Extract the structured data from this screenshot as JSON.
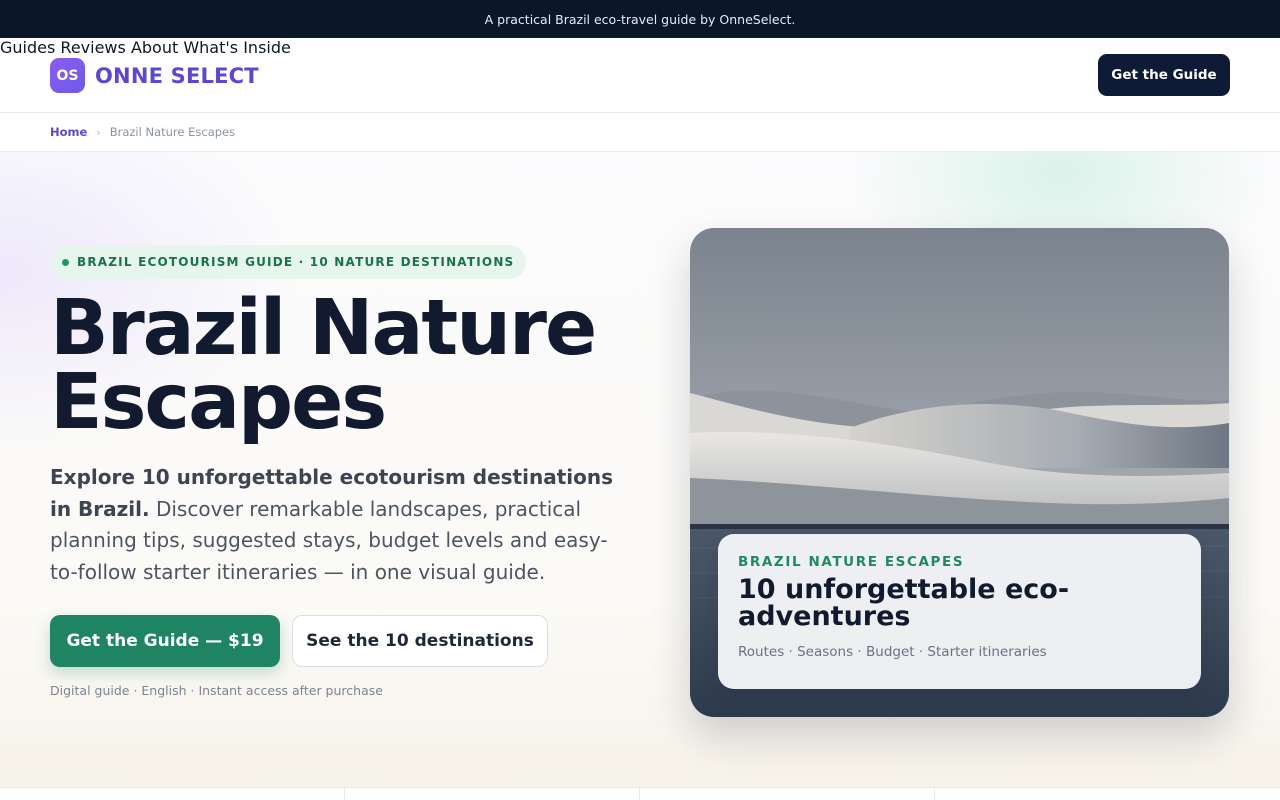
{
  "announcement": "A practical Brazil eco-travel guide by OnneSelect.",
  "brand": {
    "mark": "OS",
    "name": "ONNE SELECT"
  },
  "nav": {
    "items": [
      {
        "label": "Guides"
      },
      {
        "label": "Reviews"
      },
      {
        "label": "About"
      },
      {
        "label": "What's Inside"
      }
    ],
    "cta": "Get the Guide"
  },
  "breadcrumb": {
    "home": "Home",
    "separator": "›",
    "current": "Brazil Nature Escapes"
  },
  "hero": {
    "pill": "BRAZIL ECOTOURISM GUIDE · 10 NATURE DESTINATIONS",
    "title_line1": "Brazil Nature",
    "title_line2": "Escapes",
    "lead_strong": "Explore 10 unforgettable ecotourism destinations in Brazil.",
    "lead_rest": " Discover remarkable landscapes, practical planning tips, suggested stays, budget levels and easy-to-follow starter itineraries — in one visual guide.",
    "primary_button": "Get the Guide — $19",
    "secondary_button": "See the 10 destinations",
    "meta": "Digital guide · English · Instant access after purchase"
  },
  "feature_card": {
    "kicker": "BRAZIL NATURE ESCAPES",
    "title": "10 unforgettable eco-adventures",
    "subtitle": "Routes · Seasons · Budget · Starter itineraries"
  },
  "colors": {
    "brand_purple": "#5b47d6",
    "accent_green": "#1f8463",
    "navy": "#0e1a36"
  }
}
